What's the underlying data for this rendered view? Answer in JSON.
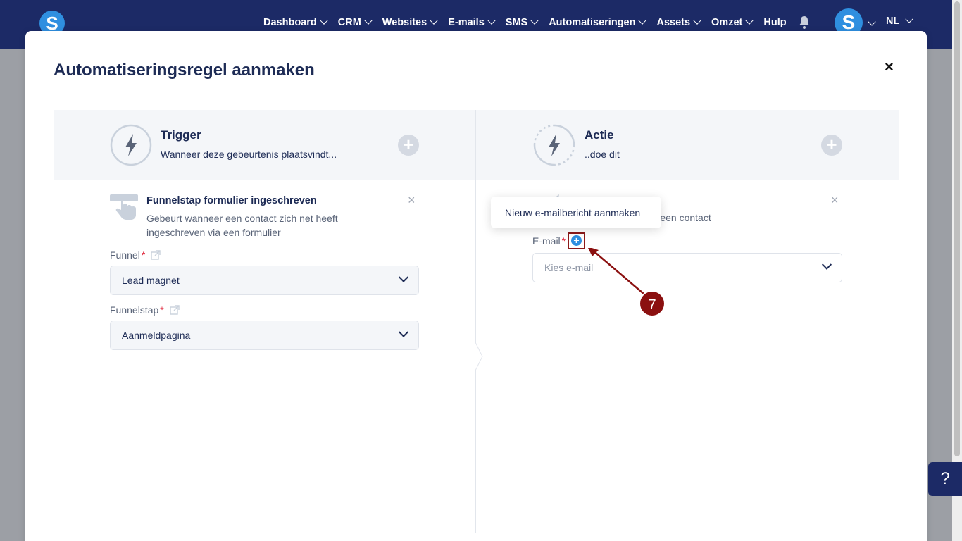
{
  "nav": {
    "logo_letter": "S",
    "items": [
      {
        "label": "Dashboard",
        "chev": true
      },
      {
        "label": "CRM",
        "chev": true
      },
      {
        "label": "Websites",
        "chev": true
      },
      {
        "label": "E-mails",
        "chev": true
      },
      {
        "label": "SMS",
        "chev": true
      },
      {
        "label": "Automatiseringen",
        "chev": true
      },
      {
        "label": "Assets",
        "chev": true
      },
      {
        "label": "Omzet",
        "chev": true
      },
      {
        "label": "Hulp",
        "chev": false
      }
    ],
    "avatar_letter": "S",
    "language": "NL"
  },
  "modal": {
    "title": "Automatiseringsregel aanmaken",
    "close": "×",
    "trigger": {
      "title": "Trigger",
      "subtitle": "Wanneer deze gebeurtenis plaatsvindt..."
    },
    "action": {
      "title": "Actie",
      "subtitle": "..doe dit"
    },
    "trigger_step": {
      "title": "Funnelstap formulier ingeschreven",
      "description": "Gebeurt wanneer een contact zich net heeft ingeschreven via een formulier",
      "remove": "×"
    },
    "funnel": {
      "label": "Funnel",
      "required": "*",
      "value": "Lead magnet"
    },
    "funnelstap": {
      "label": "Funnelstap",
      "required": "*",
      "value": "Aanmeldpagina"
    },
    "action_step": {
      "description_visible": "ur een contact",
      "remove": "×"
    },
    "email": {
      "label": "E-mail",
      "required": "*",
      "add_icon": "+",
      "placeholder": "Kies e-mail"
    },
    "tooltip": "Nieuw e-mailbericht aanmaken"
  },
  "annotation": {
    "step_number": "7",
    "color": "#8b1010"
  },
  "help_button": "?",
  "colors": {
    "nav_bg": "#1c2a66",
    "accent": "#2f8fe0",
    "required": "#e0263b"
  }
}
